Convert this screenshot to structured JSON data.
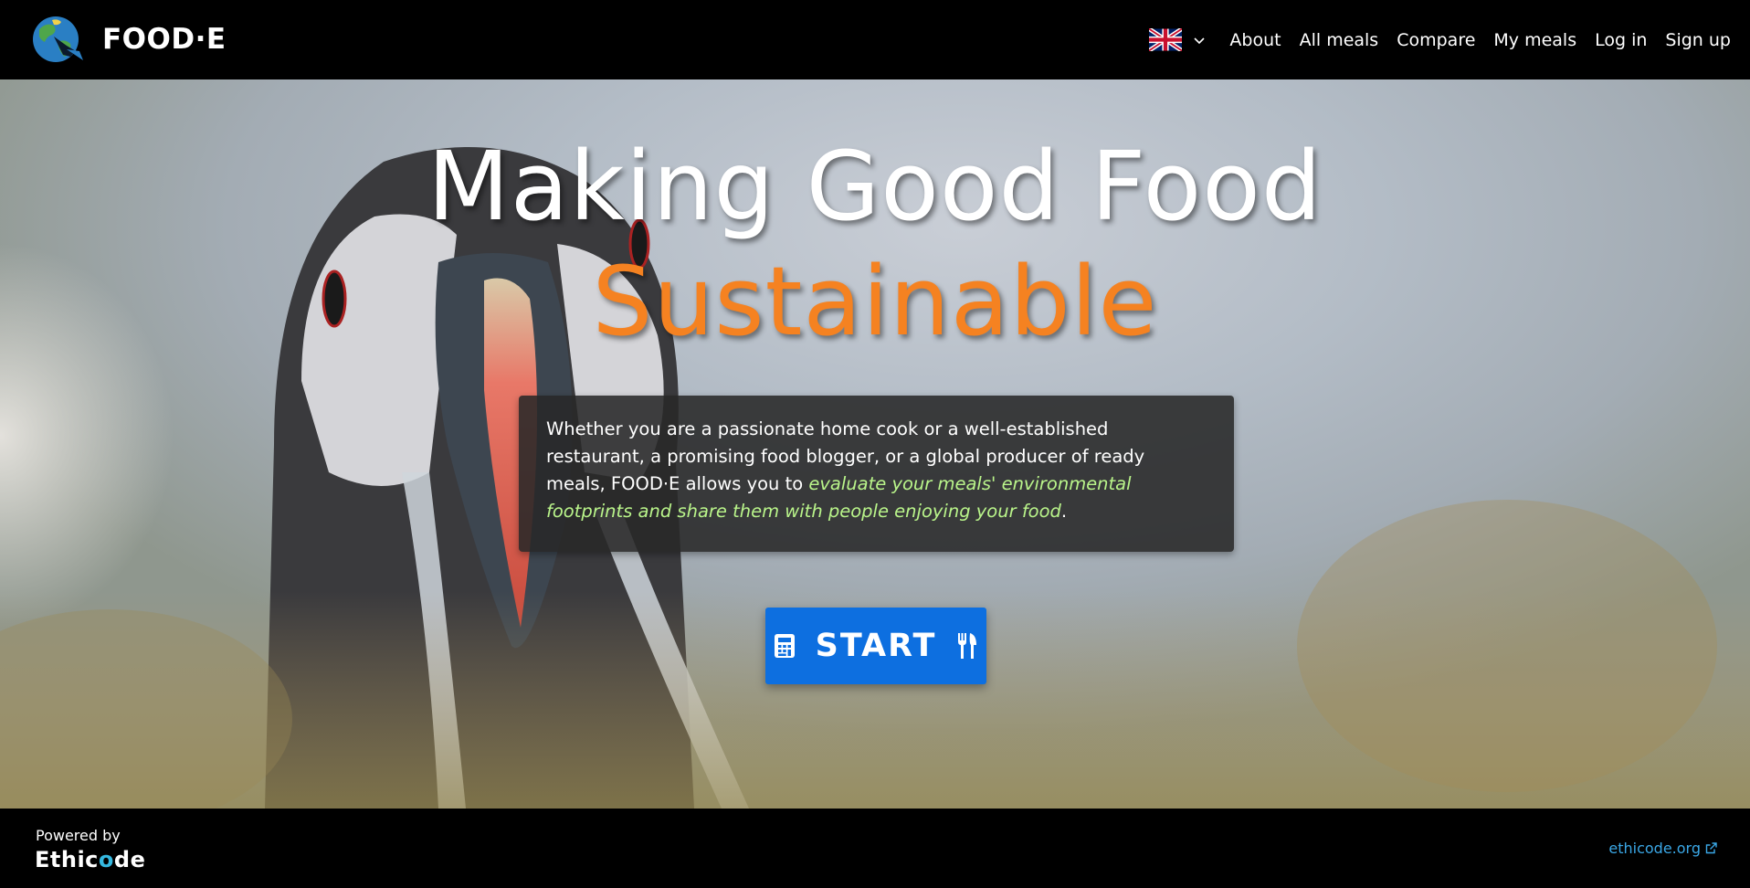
{
  "header": {
    "brand_name": "FOOD·E",
    "language": "English",
    "nav": [
      "About",
      "All meals",
      "Compare",
      "My meals",
      "Log in",
      "Sign up"
    ]
  },
  "hero": {
    "headline_line1": "Making Good Food",
    "headline_line2": "Sustainable",
    "intro_plain": "Whether you are a passionate home cook or a well-established restaurant, a promising food blogger, or a global producer of ready meals, FOOD·E allows you to ",
    "intro_highlight": "evaluate your meals' environmental footprints and share them with people enjoying your food",
    "intro_end": ".",
    "start_label": "START"
  },
  "footer": {
    "powered_by": "Powered by",
    "ethicode_brand": "Ethicode",
    "ethicode_link": "ethicode.org"
  },
  "colors": {
    "accent_orange": "#f58221",
    "highlight_green": "#b9f48a",
    "button_blue": "#0d6fe0",
    "link_blue": "#3aa7e6"
  }
}
